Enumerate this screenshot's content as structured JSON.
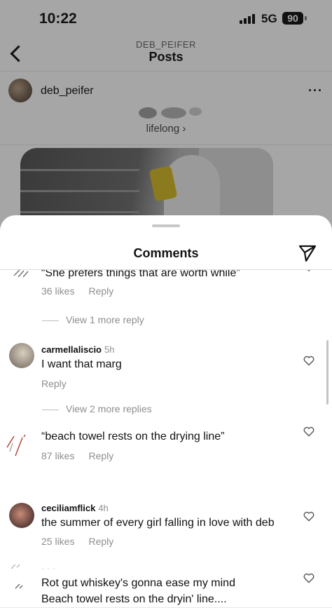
{
  "status_bar": {
    "time": "10:22",
    "network": "5G",
    "battery": "90"
  },
  "nav": {
    "subtitle": "DEB_PEIFER",
    "title": "Posts"
  },
  "post": {
    "username": "deb_peifer",
    "music_label": "lifelong",
    "more_icon": "more-options-icon"
  },
  "comments_sheet": {
    "title": "Comments",
    "items": [
      {
        "username": "",
        "time": "",
        "text": "“She prefers things that are worth while”",
        "likes": "36 likes",
        "reply": "Reply"
      },
      {
        "username": "carmellaliscio",
        "time": "5h",
        "text": "I want that marg",
        "likes": "",
        "reply": "Reply"
      },
      {
        "username": "",
        "time": "",
        "text": "“beach towel rests on the drying line”",
        "likes": "87 likes",
        "reply": "Reply"
      },
      {
        "username": "ceciliamflick",
        "time": "4h",
        "text": "the summer of every girl falling in love with deb",
        "likes": "25 likes",
        "reply": "Reply"
      },
      {
        "username": "",
        "time": "",
        "text": "Rot gut whiskey's gonna ease my mind",
        "text2": "Beach towel rests on the dryin' line....",
        "likes": "",
        "reply": ""
      }
    ],
    "view_replies": [
      "View 1 more reply",
      "View 2 more replies"
    ]
  }
}
